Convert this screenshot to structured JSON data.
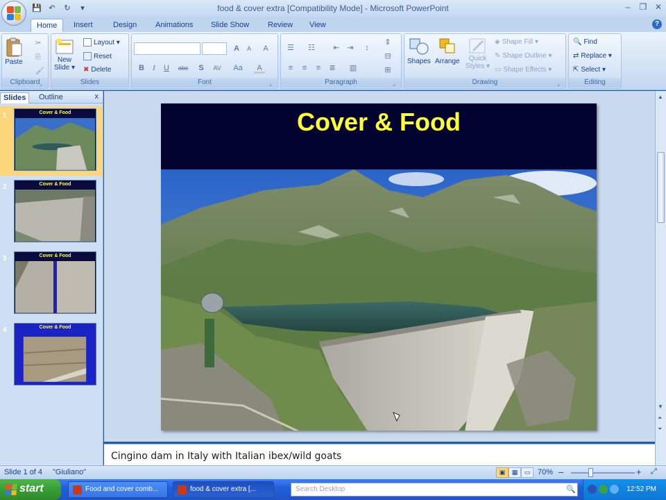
{
  "window": {
    "title": "food & cover extra [Compatibility Mode] - Microsoft PowerPoint",
    "minimize": "–",
    "restore": "❐",
    "close": "✕"
  },
  "qat": {
    "save": "💾",
    "undo": "↶",
    "redo": "↻",
    "more": "▾"
  },
  "tabs": [
    "Home",
    "Insert",
    "Design",
    "Animations",
    "Slide Show",
    "Review",
    "View"
  ],
  "active_tab": "Home",
  "ribbon": {
    "clipboard": {
      "label": "Clipboard",
      "paste": "Paste"
    },
    "slides": {
      "label": "Slides",
      "new_slide_1": "New",
      "new_slide_2": "Slide ▾",
      "layout": "Layout ▾",
      "reset": "Reset",
      "delete": "Delete"
    },
    "font": {
      "label": "Font",
      "bold": "B",
      "italic": "I",
      "underline": "U",
      "strike": "abc",
      "shadow": "S",
      "spacing": "AV",
      "case": "Aa",
      "color": "A",
      "grow": "A",
      "shrink": "A",
      "clear": "A"
    },
    "paragraph": {
      "label": "Paragraph"
    },
    "drawing": {
      "label": "Drawing",
      "shapes": "Shapes",
      "arrange": "Arrange",
      "quick_styles_1": "Quick",
      "quick_styles_2": "Styles ▾",
      "shape_fill": "Shape Fill ▾",
      "shape_outline": "Shape Outline ▾",
      "shape_effects": "Shape Effects ▾"
    },
    "editing": {
      "label": "Editing",
      "find": "Find",
      "replace": "Replace ▾",
      "select": "Select ▾"
    }
  },
  "left_pane": {
    "tab_slides": "Slides",
    "tab_outline": "Outline",
    "close": "x",
    "thumbnails": [
      {
        "num": "1",
        "title": "Cover & Food"
      },
      {
        "num": "2",
        "title": "Cover & Food"
      },
      {
        "num": "3",
        "title": "Cover & Food"
      },
      {
        "num": "4",
        "title": "Cover & Food"
      }
    ]
  },
  "slide": {
    "title": "Cover & Food"
  },
  "notes": "Cingino dam in Italy with Italian ibex/wild goats",
  "status": {
    "slide_info": "Slide 1 of 4",
    "theme": "\"Giuliano\"",
    "zoom": "70%",
    "zoom_minus": "–",
    "zoom_plus": "+"
  },
  "taskbar": {
    "start": "start",
    "task1": "Food and cover comb...",
    "task2": "food & cover extra [...",
    "search_placeholder": "Search Desktop",
    "clock": "12:52 PM"
  }
}
